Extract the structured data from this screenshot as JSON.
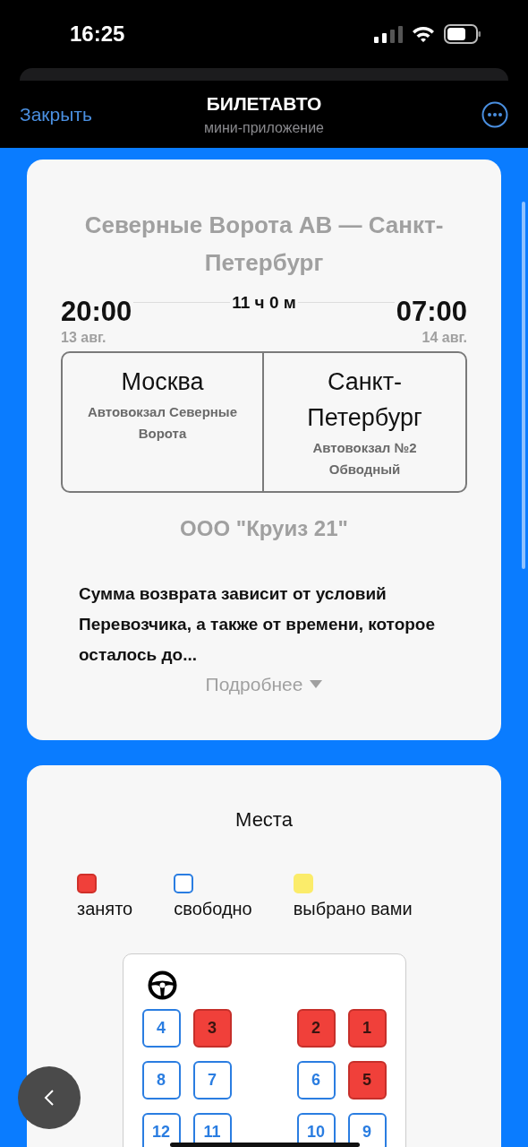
{
  "status_bar": {
    "time": "16:25"
  },
  "header": {
    "close": "Закрыть",
    "title": "БИЛЕТАВТО",
    "subtitle": "мини-приложение"
  },
  "trip": {
    "title": "Северные Ворота АВ — Санкт-Петербург",
    "departure": {
      "time": "20:00",
      "date": "13 авг."
    },
    "duration": "11 ч 0 м",
    "arrival": {
      "time": "07:00",
      "date": "14 авг."
    },
    "stations": [
      {
        "city": "Москва",
        "station": "Автовокзал Северные Ворота"
      },
      {
        "city": "Санкт-Петербург",
        "station": "Автовокзал №2 Обводный"
      }
    ],
    "carrier": "ООО \"Круиз 21\"",
    "description": "Сумма возврата зависит от условий Перевозчика, а также от времени, которое осталось до...",
    "more": "Подробнее"
  },
  "seats": {
    "title": "Места",
    "legend": [
      {
        "kind": "occupied",
        "label": "занято"
      },
      {
        "kind": "free",
        "label": "свободно"
      },
      {
        "kind": "selected",
        "label": "выбрано вами"
      }
    ],
    "rows": [
      [
        {
          "number": "4",
          "occupied": false
        },
        {
          "number": "3",
          "occupied": true
        },
        {
          "number": "2",
          "occupied": true
        },
        {
          "number": "1",
          "occupied": true
        }
      ],
      [
        {
          "number": "8",
          "occupied": false
        },
        {
          "number": "7",
          "occupied": false
        },
        {
          "number": "6",
          "occupied": false
        },
        {
          "number": "5",
          "occupied": true
        }
      ],
      [
        {
          "number": "12",
          "occupied": false
        },
        {
          "number": "11",
          "occupied": false
        },
        {
          "number": "10",
          "occupied": false
        },
        {
          "number": "9",
          "occupied": false
        }
      ]
    ]
  }
}
